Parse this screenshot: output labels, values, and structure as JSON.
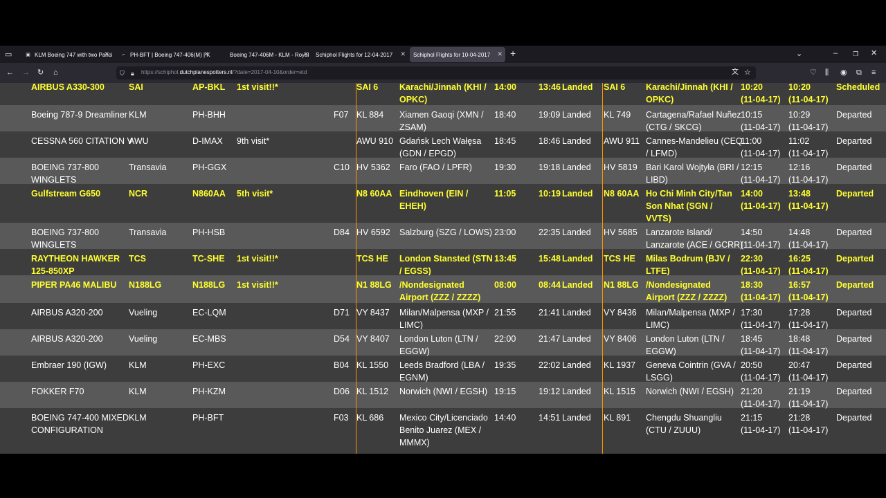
{
  "browser": {
    "tabs": [
      {
        "title": "KLM Boeing 747 with two Panda",
        "icon": "klm"
      },
      {
        "title": "PH-BFT | Boeing 747-406(M) | K",
        "icon": "jetphotos"
      },
      {
        "title": "Boeing 747-406M - KLM - Royal",
        "icon": "blank"
      },
      {
        "title": "Schiphol Flights for 12-04-2017",
        "icon": "blank"
      },
      {
        "title": "Schiphol Flights for 10-04-2017",
        "icon": "blank"
      }
    ],
    "url_prefix": "https://schiphol.",
    "url_domain": "dutchplanespotters.nl",
    "url_path": "/?date=2017-04-10&order=etd",
    "colors": {
      "chrome": "#1c1b22",
      "toolbar": "#2b2a33",
      "accent": "#ff9400"
    }
  },
  "rows": [
    {
      "type": "AIRBUS A330-300",
      "op": "SAI",
      "reg": "AP-BKL",
      "visit": "1st visit!!*",
      "gate": "",
      "arr_flight": "SAI 6",
      "from": "Karachi/Jinnah (KHI /\nOPKC)",
      "sta": "14:00",
      "ata": "13:46",
      "arr_status": "Landed",
      "dep_flight": "SAI 6",
      "to": "Karachi/Jinnah (KHI /\nOPKC)",
      "std": "10:20\n(11-04-17)",
      "etd": "10:20\n(11-04-17)",
      "dep_status": "Scheduled",
      "highlight": true
    },
    {
      "type": "Boeing 787-9 Dreamliner",
      "op": "KLM",
      "reg": "PH-BHH",
      "visit": "",
      "gate": "F07",
      "arr_flight": "KL 884",
      "from": "Xiamen Gaoqi (XMN /\nZSAM)",
      "sta": "18:40",
      "ata": "19:09",
      "arr_status": "Landed",
      "dep_flight": "KL 749",
      "to": "Cartagena/Rafael Nuñez\n(CTG / SKCG)",
      "std": "10:15\n(11-04-17)",
      "etd": "10:29\n(11-04-17)",
      "dep_status": "Departed",
      "highlight": false
    },
    {
      "type": "CESSNA 560 CITATION V",
      "op": "AWU",
      "reg": "D-IMAX",
      "visit": "9th visit*",
      "gate": "",
      "arr_flight": "AWU 910",
      "from": "Gdańsk Lech Wałęsa\n(GDN / EPGD)",
      "sta": "18:45",
      "ata": "18:46",
      "arr_status": "Landed",
      "dep_flight": "AWU 911",
      "to": "Cannes-Mandelieu (CEQ\n/ LFMD)",
      "std": "11:00\n(11-04-17)",
      "etd": "11:02\n(11-04-17)",
      "dep_status": "Departed",
      "highlight": false
    },
    {
      "type": "BOEING 737-800\nWINGLETS",
      "op": "Transavia",
      "reg": "PH-GGX",
      "visit": "",
      "gate": "C10",
      "arr_flight": "HV 5362",
      "from": "Faro (FAO / LPFR)",
      "sta": "19:30",
      "ata": "19:18",
      "arr_status": "Landed",
      "dep_flight": "HV 5819",
      "to": "Bari Karol Wojtyła (BRI /\nLIBD)",
      "std": "12:15\n(11-04-17)",
      "etd": "12:16\n(11-04-17)",
      "dep_status": "Departed",
      "highlight": false
    },
    {
      "type": "Gulfstream G650",
      "op": "NCR",
      "reg": "N860AA",
      "visit": "5th visit*",
      "gate": "",
      "arr_flight": "N8 60AA",
      "from": "Eindhoven (EIN /\nEHEH)",
      "sta": "11:05",
      "ata": "10:19",
      "arr_status": "Landed",
      "dep_flight": "N8 60AA",
      "to": "Ho Chi Minh City/Tan\nSon Nhat (SGN /\nVVTS)",
      "std": "14:00\n(11-04-17)",
      "etd": "13:48\n(11-04-17)",
      "dep_status": "Departed",
      "highlight": true
    },
    {
      "type": "BOEING 737-800\nWINGLETS",
      "op": "Transavia",
      "reg": "PH-HSB",
      "visit": "",
      "gate": "D84",
      "arr_flight": "HV 6592",
      "from": "Salzburg (SZG / LOWS)",
      "sta": "23:00",
      "ata": "22:35",
      "arr_status": "Landed",
      "dep_flight": "HV 5685",
      "to": "Lanzarote Island/\nLanzarote (ACE / GCRR)",
      "std": "14:50\n(11-04-17)",
      "etd": "14:48\n(11-04-17)",
      "dep_status": "Departed",
      "highlight": false
    },
    {
      "type": "RAYTHEON HAWKER\n125-850XP",
      "op": "TCS",
      "reg": "TC-SHE",
      "visit": "1st visit!!*",
      "gate": "",
      "arr_flight": "TCS HE",
      "from": "London Stansted (STN\n/ EGSS)",
      "sta": "13:45",
      "ata": "15:48",
      "arr_status": "Landed",
      "dep_flight": "TCS HE",
      "to": "Milas Bodrum (BJV /\nLTFE)",
      "std": "22:30\n(11-04-17)",
      "etd": "16:25\n(11-04-17)",
      "dep_status": "Departed",
      "highlight": true
    },
    {
      "type": "PIPER PA46 MALIBU",
      "op": "N188LG",
      "reg": "N188LG",
      "visit": "1st visit!!*",
      "gate": "",
      "arr_flight": "N1 88LG",
      "from": "/Nondesignated\nAirport (ZZZ / ZZZZ)",
      "sta": "08:00",
      "ata": "08:44",
      "arr_status": "Landed",
      "dep_flight": "N1 88LG",
      "to": "/Nondesignated\nAirport (ZZZ / ZZZZ)",
      "std": "18:30\n(11-04-17)",
      "etd": "16:57\n(11-04-17)",
      "dep_status": "Departed",
      "highlight": true
    },
    {
      "type": "AIRBUS A320-200",
      "op": "Vueling",
      "reg": "EC-LQM",
      "visit": "",
      "gate": "D71",
      "arr_flight": "VY 8437",
      "from": "Milan/Malpensa (MXP /\nLIMC)",
      "sta": "21:55",
      "ata": "21:41",
      "arr_status": "Landed",
      "dep_flight": "VY 8436",
      "to": "Milan/Malpensa (MXP /\nLIMC)",
      "std": "17:30\n(11-04-17)",
      "etd": "17:28\n(11-04-17)",
      "dep_status": "Departed",
      "highlight": false
    },
    {
      "type": "AIRBUS A320-200",
      "op": "Vueling",
      "reg": "EC-MBS",
      "visit": "",
      "gate": "D54",
      "arr_flight": "VY 8407",
      "from": "London Luton (LTN /\nEGGW)",
      "sta": "22:00",
      "ata": "21:47",
      "arr_status": "Landed",
      "dep_flight": "VY 8406",
      "to": "London Luton (LTN /\nEGGW)",
      "std": "18:45\n(11-04-17)",
      "etd": "18:48\n(11-04-17)",
      "dep_status": "Departed",
      "highlight": false
    },
    {
      "type": "Embraer 190 (IGW)",
      "op": "KLM",
      "reg": "PH-EXC",
      "visit": "",
      "gate": "B04",
      "arr_flight": "KL 1550",
      "from": "Leeds Bradford (LBA /\nEGNM)",
      "sta": "19:35",
      "ata": "22:02",
      "arr_status": "Landed",
      "dep_flight": "KL 1937",
      "to": "Geneva Cointrin (GVA /\nLSGG)",
      "std": "20:50\n(11-04-17)",
      "etd": "20:47\n(11-04-17)",
      "dep_status": "Departed",
      "highlight": false
    },
    {
      "type": "FOKKER F70",
      "op": "KLM",
      "reg": "PH-KZM",
      "visit": "",
      "gate": "D06",
      "arr_flight": "KL 1512",
      "from": "Norwich (NWI / EGSH)",
      "sta": "19:15",
      "ata": "19:12",
      "arr_status": "Landed",
      "dep_flight": "KL 1515",
      "to": "Norwich (NWI / EGSH)",
      "std": "21:20\n(11-04-17)",
      "etd": "21:19\n(11-04-17)",
      "dep_status": "Departed",
      "highlight": false
    },
    {
      "type": "BOEING 747-400 MIXED\nCONFIGURATION",
      "op": "KLM",
      "reg": "PH-BFT",
      "visit": "",
      "gate": "F03",
      "arr_flight": "KL 686",
      "from": "Mexico City/Licenciado\nBenito Juarez (MEX /\nMMMX)",
      "sta": "14:40",
      "ata": "14:51",
      "arr_status": "Landed",
      "dep_flight": "KL 891",
      "to": "Chengdu Shuangliu\n(CTU / ZUUU)",
      "std": "21:15\n(11-04-17)",
      "etd": "21:28\n(11-04-17)",
      "dep_status": "Departed",
      "highlight": false
    }
  ]
}
